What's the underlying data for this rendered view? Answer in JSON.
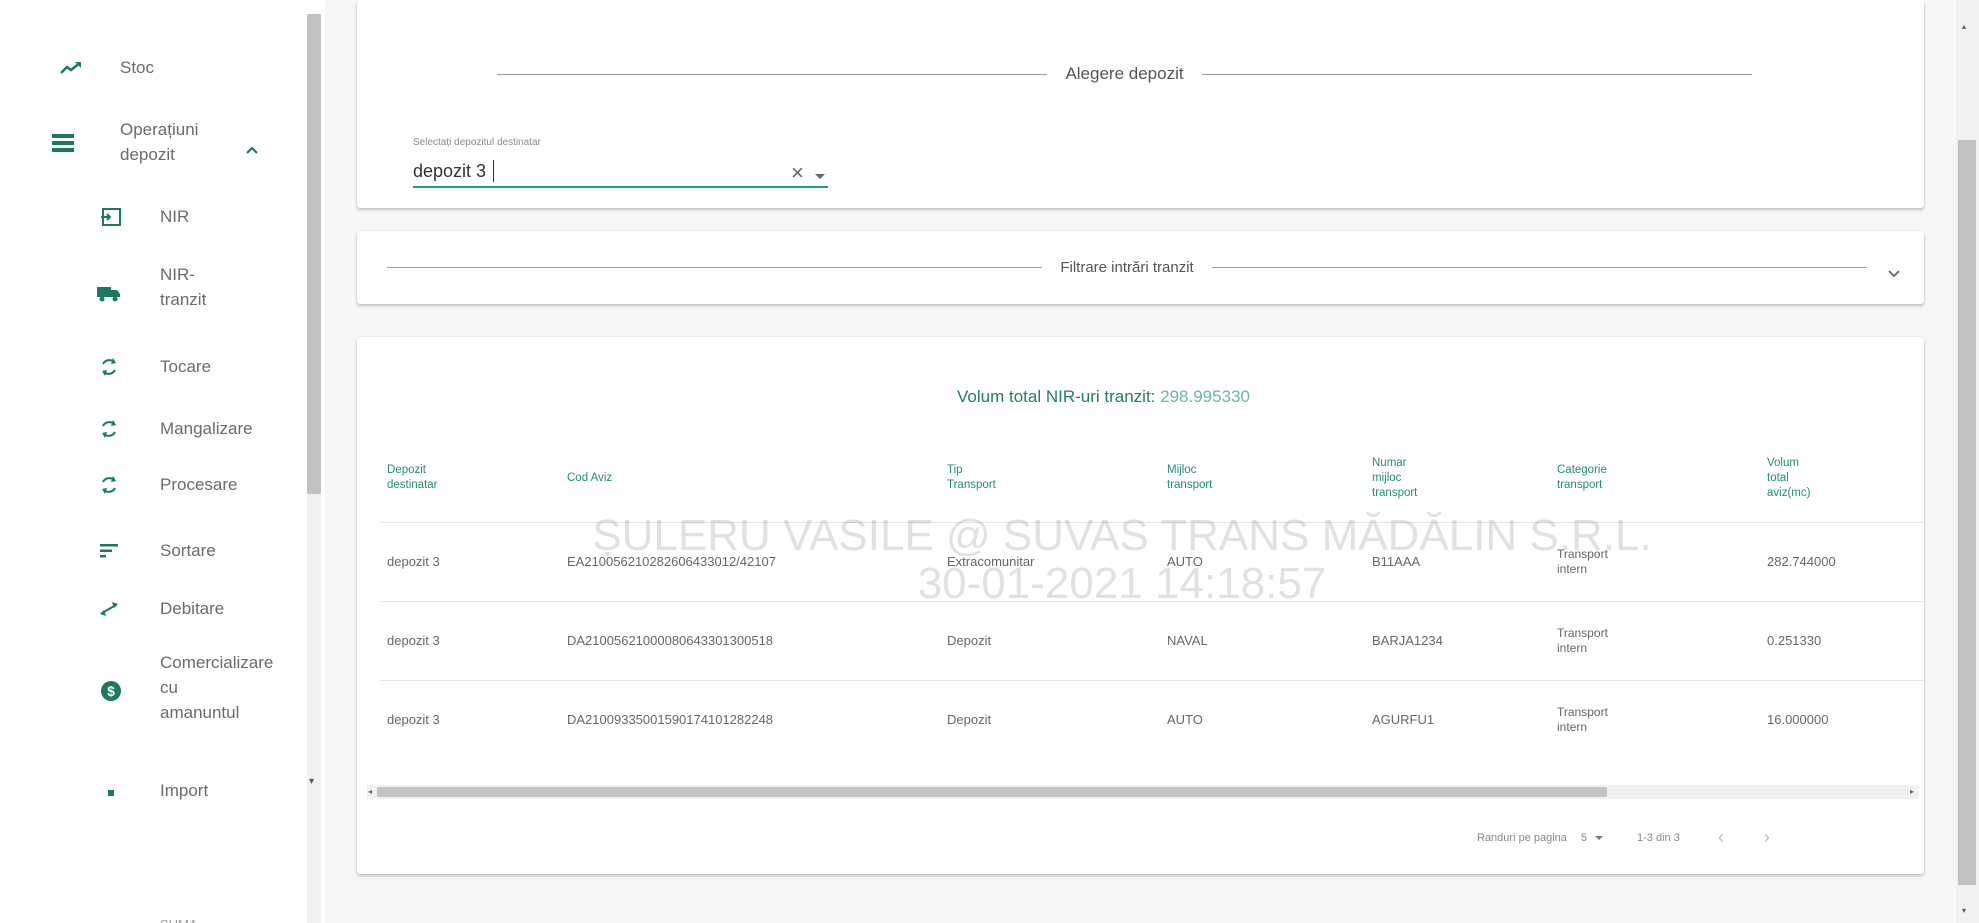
{
  "sidebar": {
    "items": [
      {
        "label": "Stoc",
        "icon": "trending-up-icon"
      },
      {
        "label": "Operațiuni\ndepozit",
        "icon": "list-icon"
      },
      {
        "label": "NIR",
        "icon": "login-icon"
      },
      {
        "label": "NIR-\ntranzit",
        "icon": "truck-icon"
      },
      {
        "label": "Tocare",
        "icon": "refresh-icon"
      },
      {
        "label": "Mangalizare",
        "icon": "refresh-icon"
      },
      {
        "label": "Procesare",
        "icon": "refresh-icon"
      },
      {
        "label": "Sortare",
        "icon": "sort-icon"
      },
      {
        "label": "Debitare",
        "icon": "swap-icon"
      },
      {
        "label": "Comercializare\ncu\namanuntul",
        "icon": "dollar-icon"
      },
      {
        "label": "Import",
        "icon": "dot-icon"
      }
    ],
    "bottom_partial": "SUMA"
  },
  "depozit_card": {
    "title": "Alegere depozit",
    "select_label": "Selectați depozitul destinatar",
    "select_value": "depozit 3"
  },
  "filter_card": {
    "title": "Filtrare intrări tranzit"
  },
  "results": {
    "total_label": "Volum total NIR-uri tranzit:",
    "total_value": "298.995330",
    "columns": [
      "Depozit\ndestinatar",
      "Cod Aviz",
      "Tip\nTransport",
      "Mijloc\ntransport",
      "Numar\nmijloc\ntransport",
      "Categorie\ntransport",
      "Volum\ntotal\naviz(mc)"
    ],
    "rows": [
      [
        "depozit 3",
        "EA210056210282606433012/42107",
        "Extracomunitar",
        "AUTO",
        "B11AAA",
        "Transport\nintern",
        "282.744000"
      ],
      [
        "depozit 3",
        "DA21005621000080643301300518",
        "Depozit",
        "NAVAL",
        "BARJA1234",
        "Transport\nintern",
        "0.251330"
      ],
      [
        "depozit 3",
        "DA21009335001590174101282248",
        "Depozit",
        "AUTO",
        "AGURFU1",
        "Transport\nintern",
        "16.000000"
      ]
    ],
    "rows_per_page_label": "Randuri pe pagina",
    "rows_per_page_value": "5",
    "range_text": "1-3 din 3"
  },
  "watermark": {
    "line1": "ȘULERU VASILE @ SUVAS TRANS MĂDĂLIN S.R.L.",
    "line2": "30-01-2021 14:18:57"
  },
  "colors": {
    "accent": "#1f9e7f",
    "header_text": "#1f8f73",
    "icon_green": "#1b7a5e"
  }
}
